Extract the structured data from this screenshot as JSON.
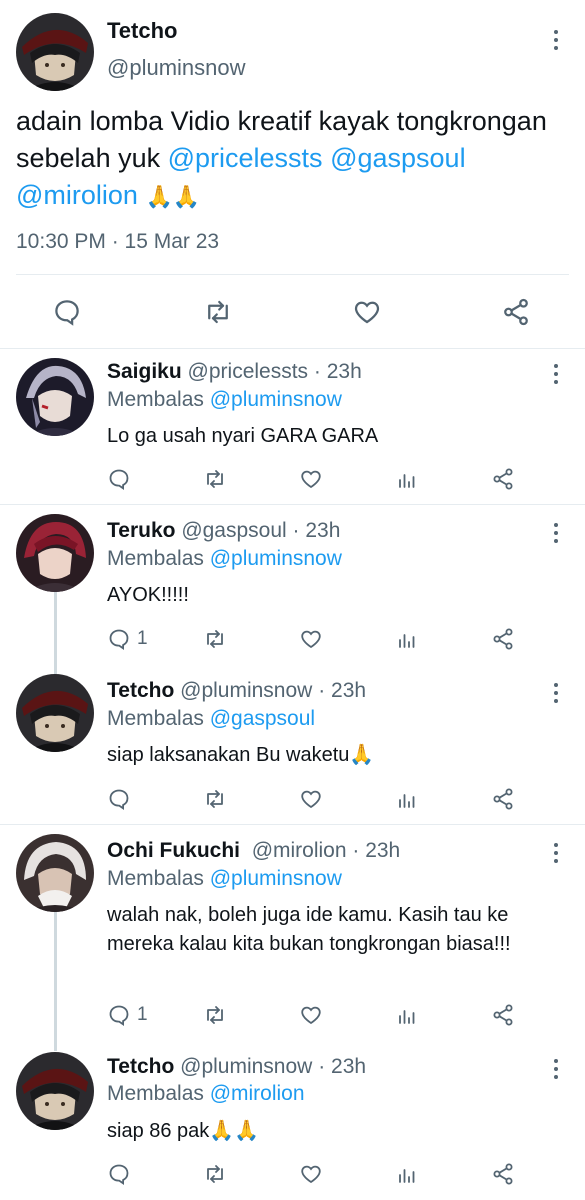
{
  "main_tweet": {
    "name": "Tetcho",
    "handle": "@pluminsnow",
    "text_plain": "adain lomba Vidio kreatif kayak tongkrongan sebelah yuk ",
    "mentions": [
      "@pricelessts",
      "@gaspsoul",
      "@mirolion"
    ],
    "emoji": "🙏🙏",
    "timestamp": "10:30 PM · 15 Mar 23",
    "actions": [
      "reply-icon",
      "retweet-icon",
      "like-icon",
      "share-icon"
    ]
  },
  "replies": [
    {
      "name": "Saigiku",
      "handle": "@pricelessts",
      "time": "· 23h",
      "replying_prefix": "Membalas ",
      "replying_to": "@pluminsnow",
      "text": "Lo ga usah nyari GARA GARA",
      "reply_count": ""
    },
    {
      "name": "Teruko",
      "handle": "@gaspsoul",
      "time": "· 23h",
      "replying_prefix": "Membalas ",
      "replying_to": "@pluminsnow",
      "text": "AYOK!!!!!",
      "reply_count": "1"
    },
    {
      "name": "Tetcho",
      "handle": "@pluminsnow",
      "time": "· 23h",
      "replying_prefix": "Membalas ",
      "replying_to": "@gaspsoul",
      "text": "siap laksanakan Bu waketu🙏",
      "reply_count": ""
    },
    {
      "name": "Ochi Fukuchi",
      "handle": "@mirolion",
      "time": "· 23h",
      "replying_prefix": "Membalas ",
      "replying_to": "@pluminsnow",
      "text": "walah nak, boleh juga ide kamu. Kasih tau ke mereka kalau kita bukan tongkrongan biasa!!!",
      "reply_count": "1"
    },
    {
      "name": "Tetcho",
      "handle": "@pluminsnow",
      "time": "· 23h",
      "replying_prefix": "Membalas ",
      "replying_to": "@mirolion",
      "text": "siap 86 pak🙏🙏",
      "reply_count": ""
    }
  ],
  "colors": {
    "link": "#1d9bf0",
    "muted": "#536471",
    "text": "#0f1419",
    "divider": "#e6ecf0"
  }
}
